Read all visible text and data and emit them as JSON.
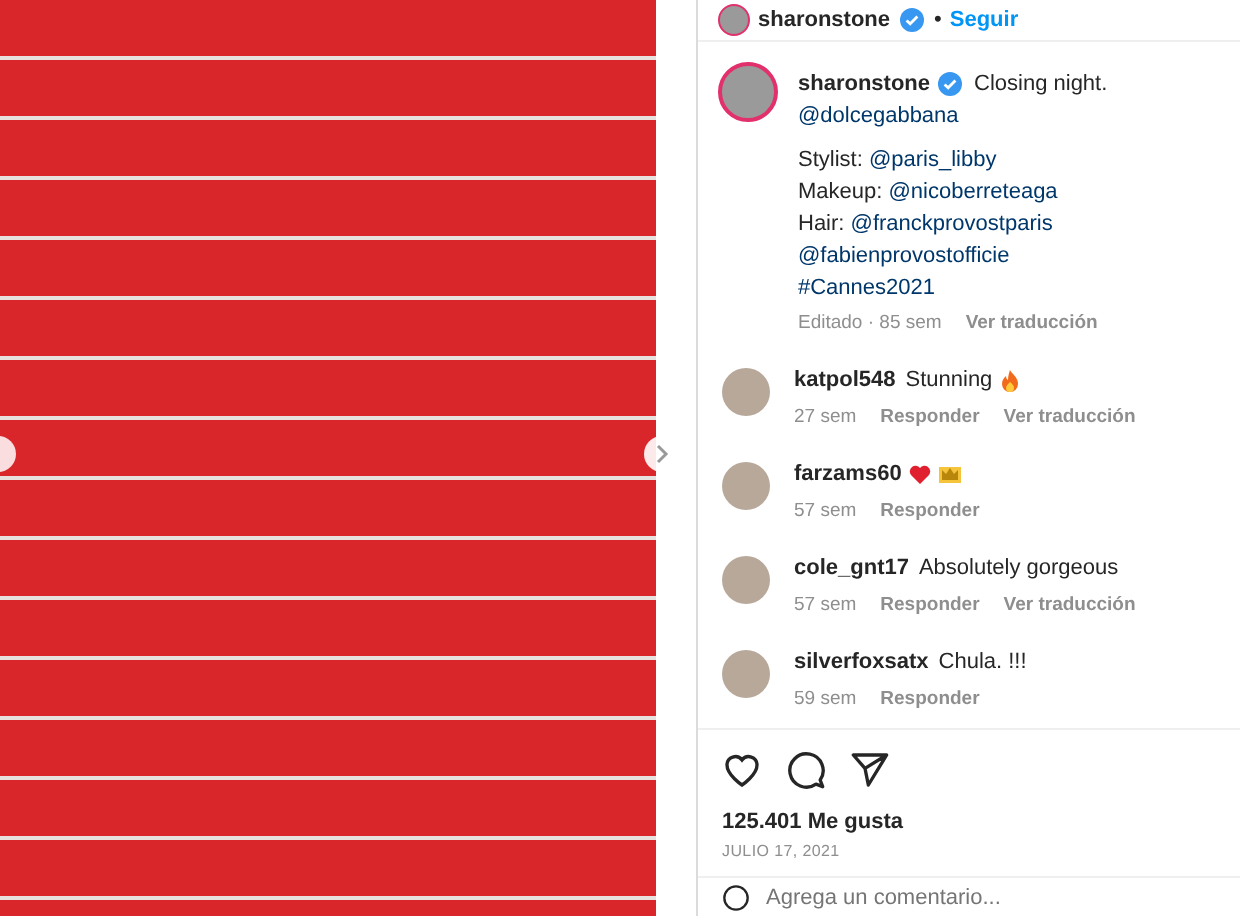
{
  "post_header": {
    "username": "sharonstone",
    "separator": "•",
    "follow": "Seguir",
    "verified": true
  },
  "caption": {
    "username": "sharonstone",
    "verified": true,
    "text": "Closing night.",
    "lines": [
      [
        {
          "kind": "link",
          "text": "@dolcegabbana"
        }
      ],
      [
        {
          "kind": "gap"
        }
      ],
      [
        {
          "kind": "text",
          "text": "Stylist: "
        },
        {
          "kind": "link",
          "text": "@paris_libby"
        }
      ],
      [
        {
          "kind": "text",
          "text": "Makeup: "
        },
        {
          "kind": "link",
          "text": "@nicoberreteaga"
        }
      ],
      [
        {
          "kind": "text",
          "text": "Hair: "
        },
        {
          "kind": "link",
          "text": "@franckprovostparis"
        },
        {
          "kind": "link",
          "text": "@fabienprovostofficie"
        }
      ],
      [
        {
          "kind": "link",
          "text": "#Cannes2021"
        }
      ]
    ],
    "meta": "Editado · 85 sem",
    "translate": "Ver traducción"
  },
  "comments": [
    {
      "username": "katpol548",
      "text": "Stunning",
      "emoji": [
        {
          "kind": "flame"
        }
      ],
      "time": "27 sem",
      "actions": [
        "Responder",
        "Ver traducción"
      ]
    },
    {
      "username": "farzams60",
      "emoji": [
        {
          "kind": "heart"
        },
        {
          "kind": "crown"
        }
      ],
      "time": "57 sem",
      "actions": [
        "Responder"
      ]
    },
    {
      "username": "cole_gnt17",
      "text": "Absolutely gorgeous",
      "time": "57 sem",
      "actions": [
        "Responder",
        "Ver traducción"
      ]
    },
    {
      "username": "silverfoxsatx",
      "text": "Chula. !!!",
      "time": "59 sem",
      "actions": [
        "Responder"
      ]
    }
  ],
  "likes": "125.401 Me gusta",
  "date": "JULIO 17, 2021",
  "comment_box": {
    "placeholder": "Agrega un comentario..."
  }
}
